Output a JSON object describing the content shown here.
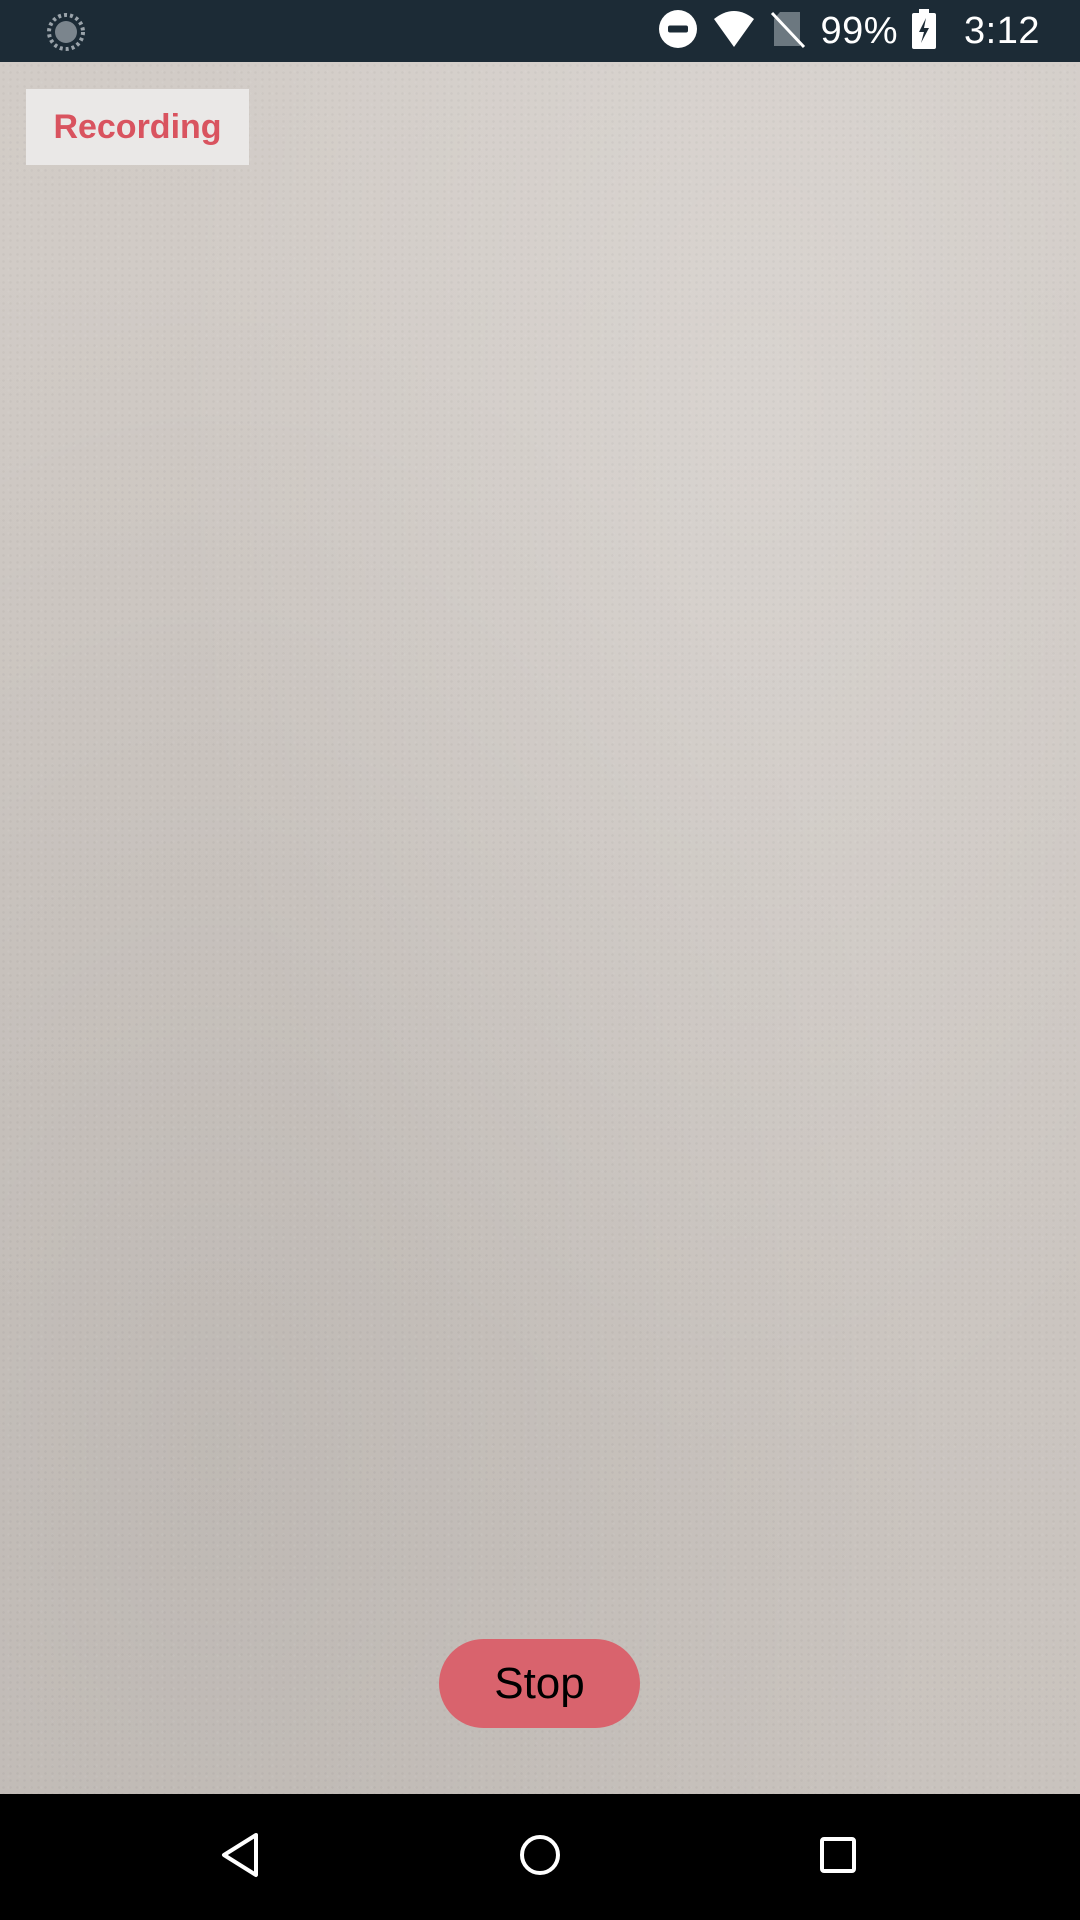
{
  "status_bar": {
    "battery_percent": "99%",
    "time": "3:12",
    "icons": [
      "loading-icon",
      "do-not-disturb-icon",
      "wifi-icon",
      "no-sim-icon",
      "battery-charging-icon"
    ]
  },
  "recording_badge": {
    "label": "Recording",
    "color": "#d9535f"
  },
  "controls": {
    "stop_label": "Stop",
    "stop_color": "#d9636d"
  },
  "nav_bar": {
    "icons": [
      "back-icon",
      "home-icon",
      "recents-icon"
    ]
  }
}
